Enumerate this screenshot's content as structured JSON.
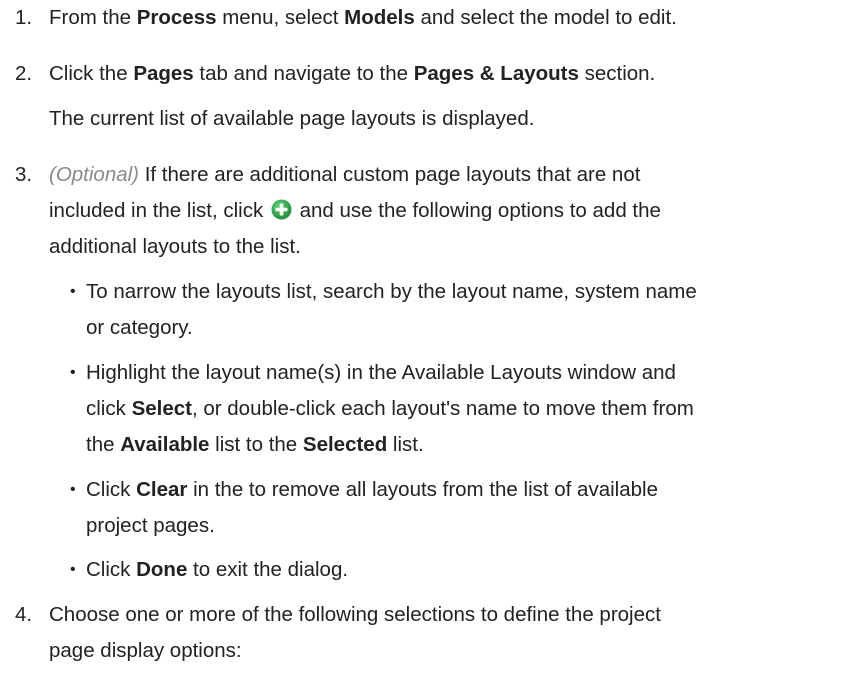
{
  "steps": [
    {
      "number": "1.",
      "parts": [
        "From the ",
        "Process",
        " menu, select ",
        "Models",
        " and select the model to edit."
      ]
    },
    {
      "number": "2.",
      "parts": [
        "Click the ",
        "Pages",
        " tab and navigate to the ",
        "Pages & Layouts",
        " section."
      ],
      "note": "The current list of available page layouts is displayed."
    },
    {
      "number": "3.",
      "optional": "(Optional)",
      "line1": " If there are additional custom page layouts that are not",
      "line2a": "included in the list, click",
      "line2b": "and use the following options to add the",
      "line3": "additional layouts to the list.",
      "bullets": [
        {
          "l1": "To narrow the layouts list, search by the layout name, system name",
          "l2": "or category."
        },
        {
          "l1": "Highlight the layout name(s) in the Available Layouts window and",
          "l2a": "click ",
          "l2b": "Select",
          "l2c": ", or double-click each layout's name to move them from",
          "l3a": "the ",
          "l3b": "Available",
          "l3c": " list to the ",
          "l3d": "Selected",
          "l3e": " list."
        },
        {
          "l1a": "Click ",
          "l1b": "Clear",
          "l1c": " in the to remove all layouts from the list of available",
          "l2": "project pages."
        },
        {
          "l1a": "Click ",
          "l1b": "Done",
          "l1c": " to exit the dialog."
        }
      ]
    },
    {
      "number": "4.",
      "line1": "Choose one or more of the following selections to define the project",
      "line2": "page display options:"
    }
  ],
  "bullet_char": "•",
  "icons": {
    "add": "plus-circle-icon"
  },
  "colors": {
    "text": "#222222",
    "optional": "#8a8a8a",
    "add_icon": "#2ea44f"
  }
}
